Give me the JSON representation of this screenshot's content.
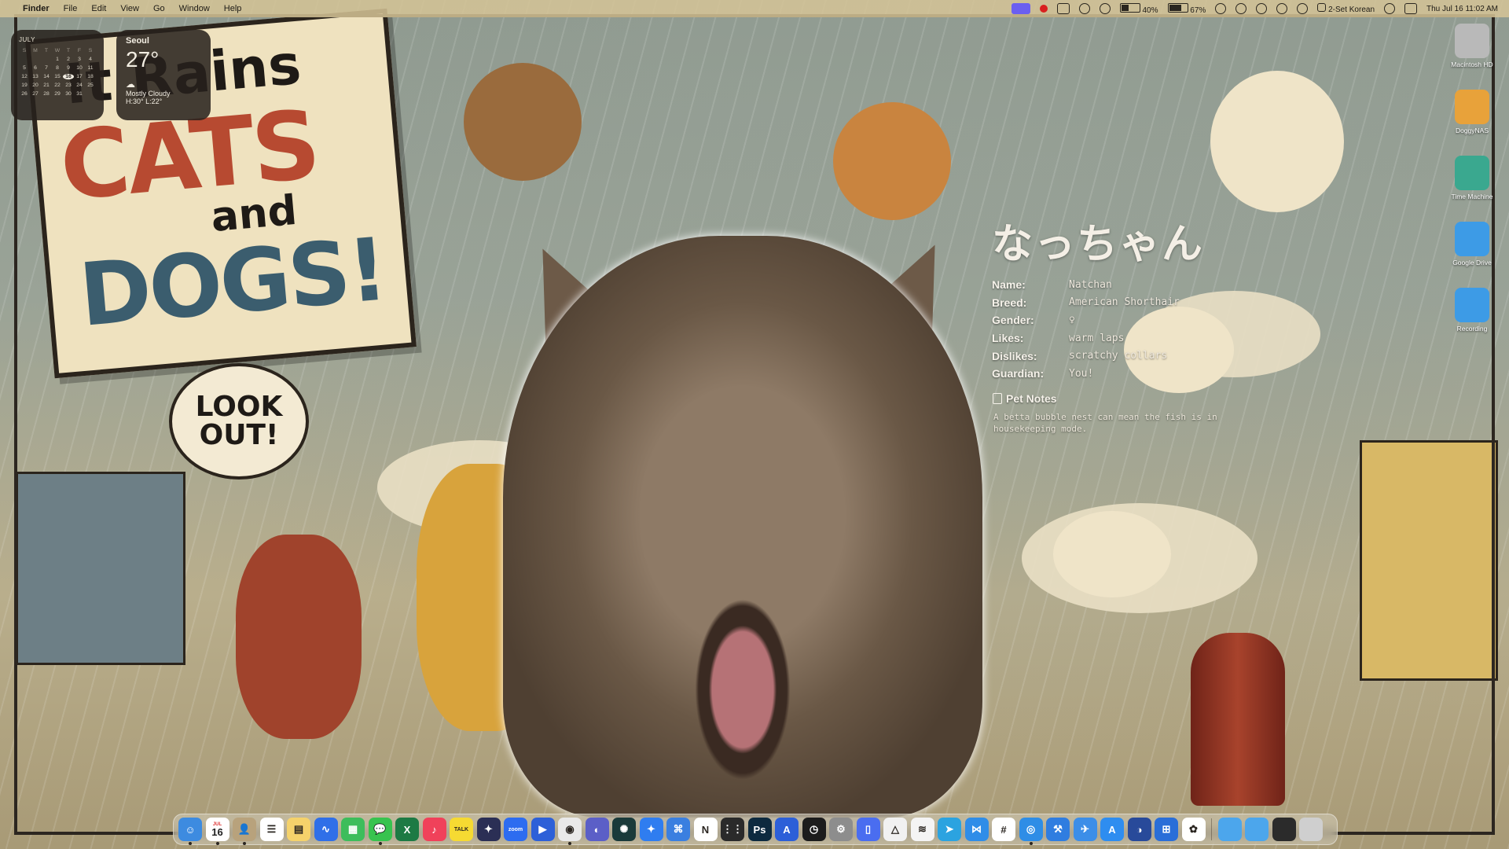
{
  "menubar": {
    "app_name": "Finder",
    "menus": [
      "File",
      "Edit",
      "View",
      "Go",
      "Window",
      "Help"
    ],
    "battery_1": "40%",
    "battery_2": "67%",
    "input_source": "2-Set Korean",
    "datetime": "Thu Jul 16  11:02 AM"
  },
  "calendar_widget": {
    "month": "JULY",
    "weekday_headers": [
      "S",
      "M",
      "T",
      "W",
      "T",
      "F",
      "S"
    ],
    "weeks": [
      {
        "week": "",
        "days": [
          "",
          "",
          "",
          "1",
          "2",
          "3",
          "4"
        ]
      },
      {
        "week": "",
        "days": [
          "5",
          "6",
          "7",
          "8",
          "9",
          "10",
          "11"
        ]
      },
      {
        "week": "",
        "days": [
          "12",
          "13",
          "14",
          "15",
          "16",
          "17",
          "18"
        ]
      },
      {
        "week": "",
        "days": [
          "19",
          "20",
          "21",
          "22",
          "23",
          "24",
          "25"
        ]
      },
      {
        "week": "",
        "days": [
          "26",
          "27",
          "28",
          "29",
          "30",
          "31",
          ""
        ]
      }
    ],
    "today": "16"
  },
  "weather_widget": {
    "city": "Seoul",
    "temperature": "27°",
    "condition": "Mostly Cloudy",
    "high_low": "H:30° L:22°"
  },
  "wallpaper": {
    "sign_line1": "It Rains",
    "sign_line2": "CATS",
    "sign_line3": "and",
    "sign_line4": "DOGS!",
    "bubble_line1": "LOOK",
    "bubble_line2": "OUT!"
  },
  "pet_card": {
    "title": "なっちゃん",
    "rows": [
      {
        "key": "Name:",
        "value": "Natchan"
      },
      {
        "key": "Breed:",
        "value": "American Shorthair"
      },
      {
        "key": "Gender:",
        "value": "♀"
      },
      {
        "key": "Likes:",
        "value": "warm laps"
      },
      {
        "key": "Dislikes:",
        "value": "scratchy collars"
      },
      {
        "key": "Guardian:",
        "value": "You!"
      }
    ],
    "notes_heading": "Pet Notes",
    "notes_body": "A betta bubble nest can mean the fish is in housekeeping mode."
  },
  "desktop_icons": [
    {
      "label": "Macintosh HD",
      "color": "#b9b9b9"
    },
    {
      "label": "DoggyNAS",
      "color": "#e8a23a"
    },
    {
      "label": "Time Machine",
      "color": "#3aa88f"
    },
    {
      "label": "Google Drive",
      "color": "#3d9be6"
    },
    {
      "label": "Recording",
      "color": "#3d9be6"
    }
  ],
  "dock": {
    "calendar_day": "16",
    "calendar_month": "JUL",
    "apps": [
      {
        "name": "Finder",
        "color": "#3d8be0",
        "glyph": "☺"
      },
      {
        "name": "Calendar",
        "color": "#ffffff",
        "glyph": ""
      },
      {
        "name": "Contacts",
        "color": "#b8a27c",
        "glyph": "👤"
      },
      {
        "name": "Reminders",
        "color": "#ffffff",
        "glyph": "☰"
      },
      {
        "name": "Notes",
        "color": "#f5d26b",
        "glyph": "▤"
      },
      {
        "name": "Freeform",
        "color": "#2f6fe8",
        "glyph": "∿"
      },
      {
        "name": "Numbers",
        "color": "#3dbd5b",
        "glyph": "▦"
      },
      {
        "name": "Messages",
        "color": "#38c34f",
        "glyph": "💬"
      },
      {
        "name": "Excel",
        "color": "#1d7a44",
        "glyph": "X"
      },
      {
        "name": "Music",
        "color": "#f0415a",
        "glyph": "♪"
      },
      {
        "name": "KakaoTalk",
        "color": "#f6da32",
        "glyph": "TALK"
      },
      {
        "name": "Xcode Tools",
        "color": "#2b2f55",
        "glyph": "✦"
      },
      {
        "name": "Zoom",
        "color": "#2d6cf0",
        "glyph": "zoom"
      },
      {
        "name": "Remote Desktop",
        "color": "#2d60d8",
        "glyph": "▶"
      },
      {
        "name": "Chrome",
        "color": "#e9e9e9",
        "glyph": "◉"
      },
      {
        "name": "Teams",
        "color": "#5b5fc7",
        "glyph": "◐"
      },
      {
        "name": "Codex",
        "color": "#1a3a3a",
        "glyph": "✺"
      },
      {
        "name": "Spark",
        "color": "#2f7df0",
        "glyph": "✦"
      },
      {
        "name": "Network",
        "color": "#3a7fe0",
        "glyph": "⌘"
      },
      {
        "name": "Notion",
        "color": "#ffffff",
        "glyph": "N"
      },
      {
        "name": "Launchpad",
        "color": "#2a2a2a",
        "glyph": "⋮⋮"
      },
      {
        "name": "Photoshop",
        "color": "#0d2a3f",
        "glyph": "Ps"
      },
      {
        "name": "Affinity",
        "color": "#2c5fd8",
        "glyph": "A"
      },
      {
        "name": "Clock",
        "color": "#1c1c1c",
        "glyph": "◷"
      },
      {
        "name": "Settings",
        "color": "#8d8d8d",
        "glyph": "⚙"
      },
      {
        "name": "Simulator",
        "color": "#4a6df0",
        "glyph": "▯"
      },
      {
        "name": "Google Drive",
        "color": "#f1f1f1",
        "glyph": "△"
      },
      {
        "name": "Scrivener",
        "color": "#f4f4f4",
        "glyph": "≋"
      },
      {
        "name": "Telegram",
        "color": "#2ba3e0",
        "glyph": "➤"
      },
      {
        "name": "Instruments",
        "color": "#2f8de8",
        "glyph": "⋈"
      },
      {
        "name": "Slack",
        "color": "#ffffff",
        "glyph": "#"
      },
      {
        "name": "Safari",
        "color": "#2e8de6",
        "glyph": "◎"
      },
      {
        "name": "Xcode",
        "color": "#2f7de0",
        "glyph": "⚒"
      },
      {
        "name": "TestFlight",
        "color": "#3c8ee8",
        "glyph": "✈"
      },
      {
        "name": "App Store",
        "color": "#2e8df0",
        "glyph": "A"
      },
      {
        "name": "Screen Sharing",
        "color": "#284a9a",
        "glyph": "◑"
      },
      {
        "name": "Windows App",
        "color": "#2a6ed8",
        "glyph": "⊞"
      },
      {
        "name": "Photos",
        "color": "#ffffff",
        "glyph": "✿"
      }
    ],
    "right_items": [
      {
        "name": "Downloads Folder",
        "color": "#4ca6ec"
      },
      {
        "name": "Documents Folder",
        "color": "#4ca6ec"
      },
      {
        "name": "Terminal Window",
        "color": "#2b2b2b"
      },
      {
        "name": "Trash",
        "color": "#cfcfcf"
      }
    ]
  }
}
